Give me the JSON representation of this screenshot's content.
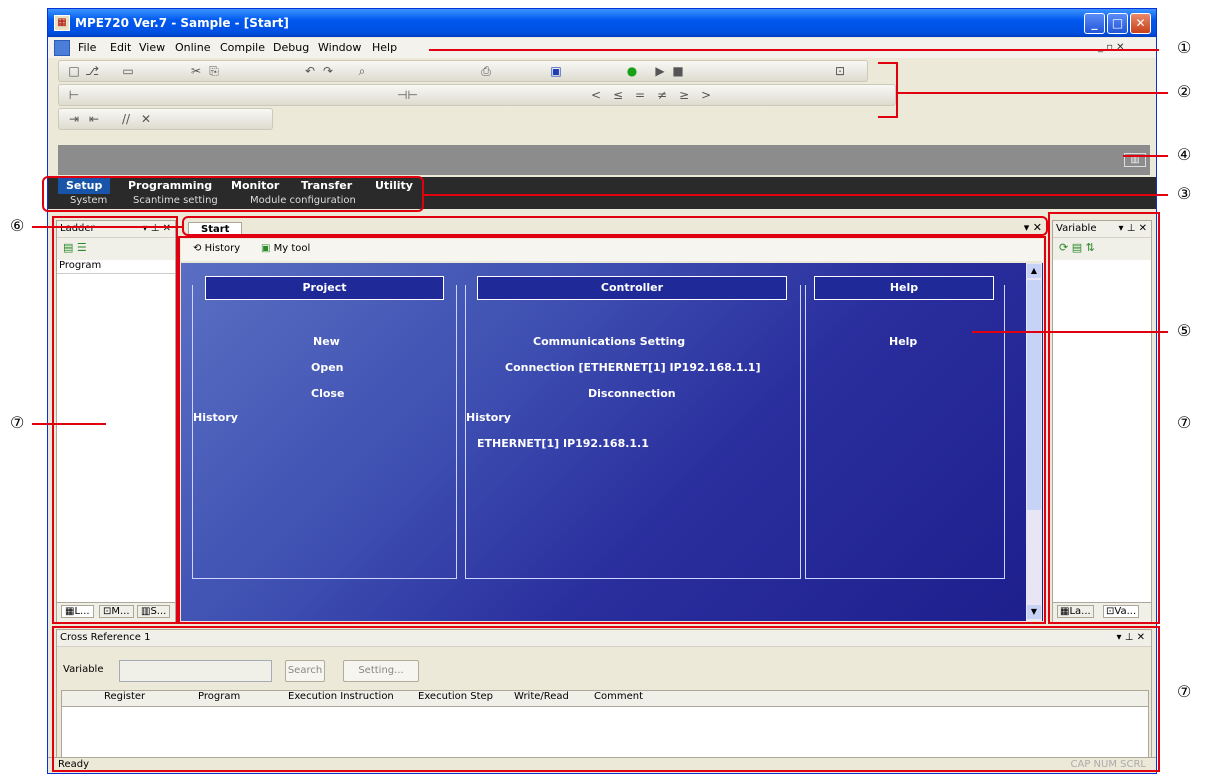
{
  "title": "MPE720 Ver.7 - Sample - [Start]",
  "menu": [
    "File",
    "Edit",
    "View",
    "Online",
    "Compile",
    "Debug",
    "Window",
    "Help"
  ],
  "main_tabs": [
    "Setup",
    "Programming",
    "Monitor",
    "Transfer",
    "Utility"
  ],
  "sub_tabs": [
    "System",
    "Scantime setting",
    "Module configuration"
  ],
  "ladder_panel": {
    "title": "Ladder",
    "tree_header": "Program",
    "bottom_tabs": [
      "L...",
      "M...",
      "S..."
    ]
  },
  "doc_tab": "Start",
  "start_toolbar": {
    "history": "History",
    "mytool": "My tool"
  },
  "project": {
    "title": "Project",
    "links": [
      "New",
      "Open",
      "Close"
    ],
    "history": "History"
  },
  "controller": {
    "title": "Controller",
    "links": [
      "Communications Setting",
      "Connection [ETHERNET[1] IP192.168.1.1]",
      "Disconnection"
    ],
    "history": "History",
    "history_item": "ETHERNET[1] IP192.168.1.1"
  },
  "help": {
    "title": "Help",
    "links": [
      "Help"
    ]
  },
  "variable_panel": {
    "title": "Variable",
    "bottom_tabs": [
      "La...",
      "Va..."
    ]
  },
  "cross_ref": {
    "title": "Cross Reference 1",
    "variable_label": "Variable",
    "search": "Search",
    "setting": "Setting...",
    "columns": [
      "Register",
      "Program",
      "Execution Instruction",
      "Execution Step",
      "Write/Read",
      "Comment"
    ]
  },
  "status": {
    "left": "Ready",
    "right": "CAP  NUM  SCRL"
  },
  "callouts": [
    "①",
    "②",
    "③",
    "④",
    "⑤",
    "⑥",
    "⑦",
    "⑦",
    "⑦"
  ]
}
